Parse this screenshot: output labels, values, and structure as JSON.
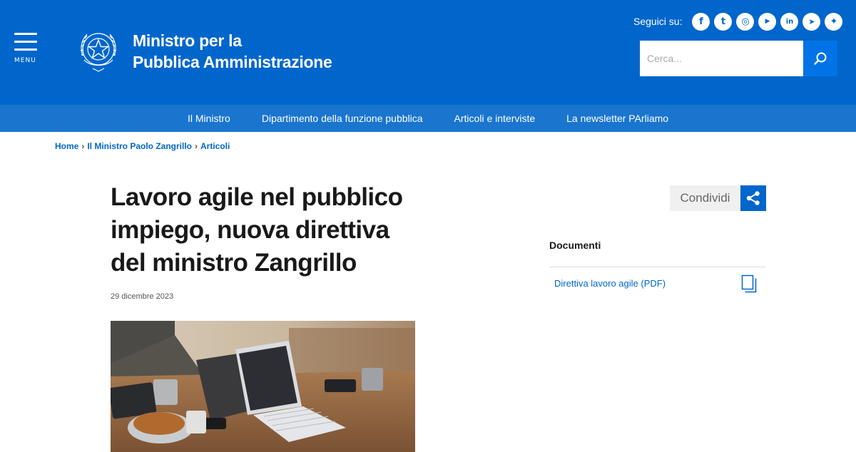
{
  "header": {
    "menu_label": "MENU",
    "brand_line1": "Ministro per la",
    "brand_line2": "Pubblica Amministrazione",
    "social_label": "Seguici su:",
    "social_icons": [
      {
        "icon": "facebook-icon",
        "glyph": "f"
      },
      {
        "icon": "twitter-icon",
        "glyph": "t"
      },
      {
        "icon": "instagram-icon",
        "glyph": "◎"
      },
      {
        "icon": "youtube-icon",
        "glyph": "▶"
      },
      {
        "icon": "linkedin-icon",
        "glyph": "in"
      },
      {
        "icon": "telegram-icon",
        "glyph": "➤"
      },
      {
        "icon": "other-social-icon",
        "glyph": "✦"
      }
    ],
    "search_placeholder": "Cerca..."
  },
  "nav": {
    "items": [
      "Il Ministro",
      "Dipartimento della funzione pubblica",
      "Articoli e interviste",
      "La newsletter PArliamo"
    ]
  },
  "breadcrumb": {
    "items": [
      "Home",
      "Il Ministro Paolo Zangrillo",
      "Articoli"
    ],
    "separator": "›"
  },
  "article": {
    "title": "Lavoro agile nel pubblico impiego, nuova direttiva del ministro Zangrillo",
    "date": "29 dicembre 2023"
  },
  "sidebar": {
    "share_label": "Condividi",
    "documents_title": "Documenti",
    "documents": [
      "Direttiva lavoro agile (PDF)"
    ]
  },
  "colors": {
    "primary": "#0066cc",
    "nav": "#1a75cf",
    "share_bg": "#f0f0f0"
  }
}
